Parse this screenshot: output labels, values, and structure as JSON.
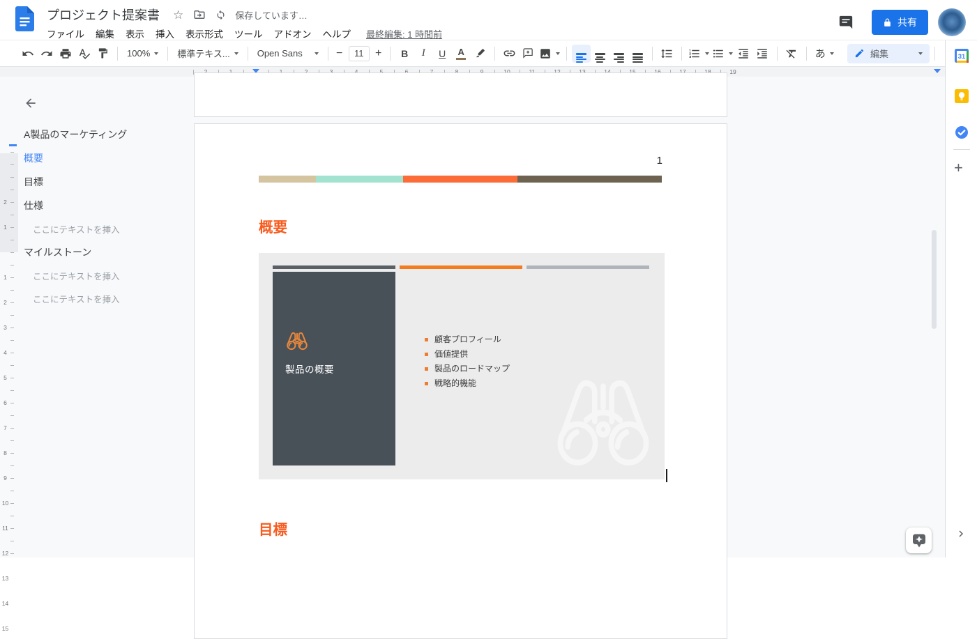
{
  "header": {
    "title": "プロジェクト提案書",
    "saving_status": "保存しています…",
    "menus": [
      "ファイル",
      "編集",
      "表示",
      "挿入",
      "表示形式",
      "ツール",
      "アドオン",
      "ヘルプ"
    ],
    "last_edit": "最終編集: 1 時間前",
    "share_label": "共有"
  },
  "toolbar": {
    "zoom_value": "100%",
    "styles_value": "標準テキス...",
    "font_value": "Open Sans",
    "font_size": "11",
    "bold": "B",
    "italic": "I",
    "underline": "U",
    "text_color": "A",
    "input_tools": "あ",
    "mode_label": "編集"
  },
  "ruler": {
    "h_left": [
      "2",
      "1"
    ],
    "h_right": [
      "1",
      "2",
      "3",
      "4",
      "5",
      "6",
      "7",
      "8",
      "9",
      "10",
      "11",
      "12",
      "13",
      "14",
      "15",
      "16",
      "17",
      "18",
      "19"
    ],
    "v_top": [
      "2",
      "1"
    ],
    "v_bottom": [
      "1",
      "2",
      "3",
      "4",
      "5",
      "6",
      "7",
      "8",
      "9",
      "10",
      "11",
      "12",
      "13",
      "14",
      "15"
    ]
  },
  "outline": {
    "items": [
      {
        "label": "A製品のマーケティング"
      },
      {
        "label": "概要"
      },
      {
        "label": "目標"
      },
      {
        "label": "仕様"
      },
      {
        "label": "ここにテキストを挿入"
      },
      {
        "label": "マイルストーン"
      },
      {
        "label": "ここにテキストを挿入"
      },
      {
        "label": "ここにテキストを挿入"
      }
    ]
  },
  "document": {
    "page_number": "1",
    "overview_heading": "概要",
    "goals_heading": "目標",
    "divider_colors": [
      "#d5c4a0",
      "#a3e2cf",
      "#fb6c38",
      "#6e6350"
    ],
    "heading_color": "#f75b1f",
    "slide": {
      "panel_title": "製品の概要",
      "bullets": [
        "顧客プロフィール",
        "価値提供",
        "製品のロードマップ",
        "戦略的機能"
      ],
      "panel_color": "#485058",
      "bar_colors": [
        "#5a6065",
        "#f47b20",
        "#aeb4b9"
      ],
      "accent_orange": "#ed7d31"
    }
  }
}
